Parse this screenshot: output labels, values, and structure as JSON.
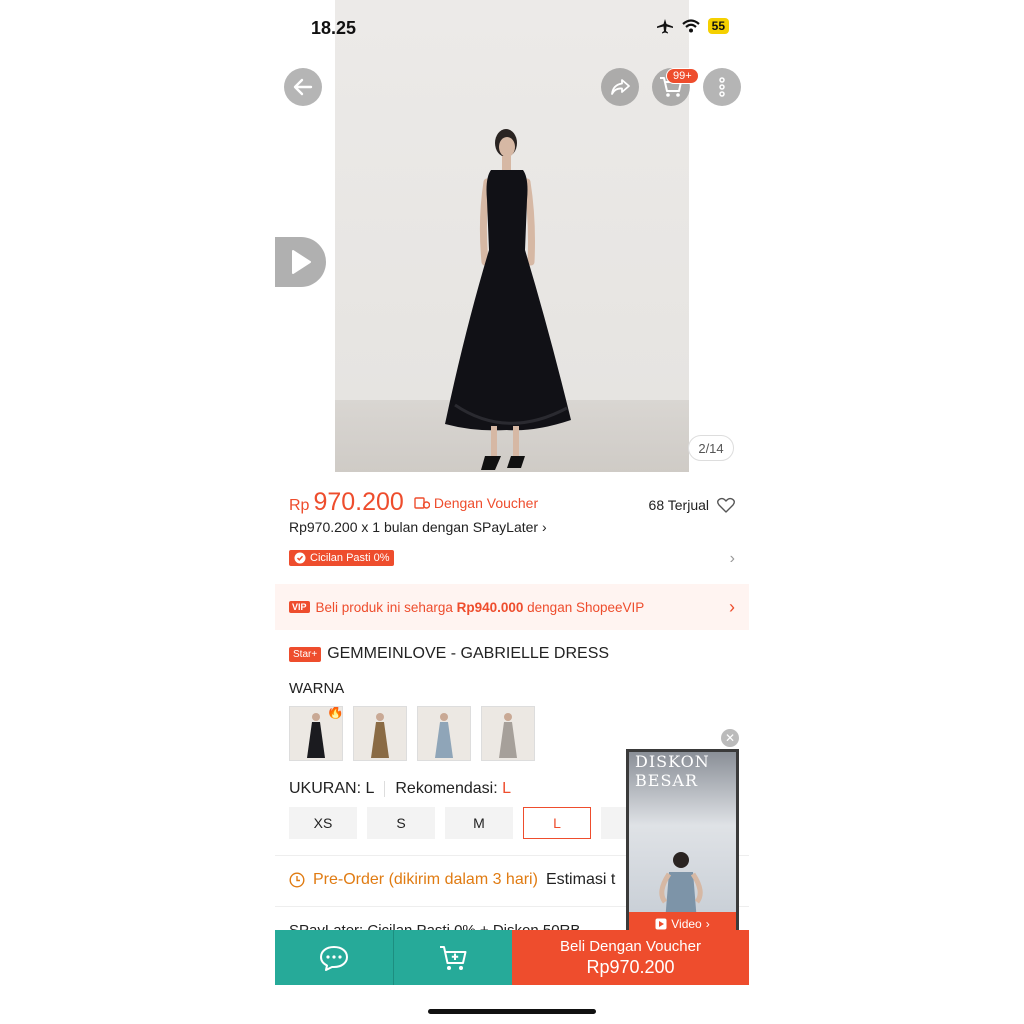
{
  "status_bar": {
    "time": "18.25",
    "battery": "55"
  },
  "header": {
    "cart_badge": "99+"
  },
  "gallery": {
    "counter": "2/14"
  },
  "price": {
    "currency": "Rp",
    "amount": "970.200",
    "voucher_label": "Dengan Voucher",
    "sold": "68 Terjual",
    "paylater": "Rp970.200 x 1 bulan dengan SPayLater",
    "cicilan_badge": "Cicilan Pasti 0%"
  },
  "vip_banner": {
    "tag": "VIP",
    "text_prefix": "Beli produk ini seharga ",
    "vip_price": "Rp940.000",
    "text_suffix": " dengan ShopeeVIP"
  },
  "product": {
    "store_tag": "Star+",
    "title": "GEMMEINLOVE - GABRIELLE DRESS"
  },
  "variants": {
    "warna_label": "WARNA",
    "swatch_colors": [
      "#1b1b1f",
      "#8a6b45",
      "#8fa5b8",
      "#a6a09a"
    ]
  },
  "sizes": {
    "label": "UKURAN: L",
    "recommend_label": "Rekomendasi:",
    "recommend_value": "L",
    "options": [
      "XS",
      "S",
      "M",
      "L"
    ],
    "selected": "L"
  },
  "shipping": {
    "preorder": "Pre-Order (dikirim dalam 3 hari)",
    "estimate": "Estimasi t"
  },
  "spaylater_row": "SPayLater: Cicilan Pasti 0% + Diskon 50RB",
  "float_video": {
    "overlay_text": "DISKON BESAR",
    "button": "Video"
  },
  "bottom_bar": {
    "buy_label": "Beli Dengan Voucher",
    "buy_price": "Rp970.200"
  },
  "colors": {
    "accent": "#ee4d2d",
    "teal": "#26aa99",
    "preorder": "#e07b12"
  }
}
